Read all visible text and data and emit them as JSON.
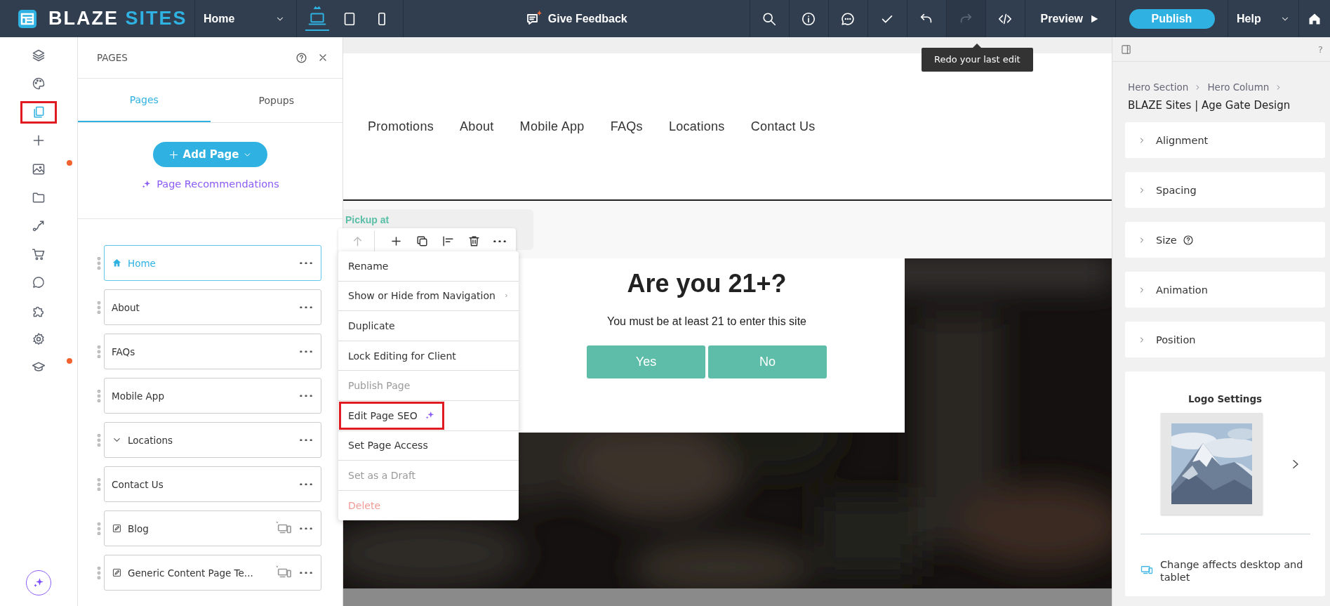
{
  "top_bar": {
    "logo": {
      "primary": "BLAZE",
      "accent": "SITES"
    },
    "page_select": {
      "value": "Home"
    },
    "devices": [
      {
        "kind": "desktop",
        "selected": true
      },
      {
        "kind": "tablet",
        "selected": false
      },
      {
        "kind": "mobile",
        "selected": false
      }
    ],
    "feedback": "Give Feedback",
    "tools": [
      {
        "kind": "search",
        "disabled": false
      },
      {
        "kind": "info",
        "disabled": false
      },
      {
        "kind": "comments",
        "disabled": false
      },
      {
        "kind": "check",
        "disabled": false
      },
      {
        "kind": "undo",
        "disabled": false
      },
      {
        "kind": "redo",
        "disabled": true
      },
      {
        "kind": "code",
        "disabled": false
      }
    ],
    "preview": "Preview",
    "publish": "Publish",
    "help": "Help"
  },
  "tooltip": "Redo your last edit",
  "rail": {
    "items": [
      {
        "kind": "layers",
        "selected": false,
        "highlighted": false,
        "badge": false
      },
      {
        "kind": "palette",
        "selected": false,
        "highlighted": false,
        "badge": false
      },
      {
        "kind": "pages",
        "selected": true,
        "highlighted": true,
        "badge": false
      },
      {
        "kind": "add",
        "selected": false,
        "highlighted": false,
        "badge": false
      },
      {
        "kind": "media",
        "selected": false,
        "highlighted": false,
        "badge": true
      },
      {
        "kind": "folder",
        "selected": false,
        "highlighted": false,
        "badge": false
      },
      {
        "kind": "flow",
        "selected": false,
        "highlighted": false,
        "badge": false
      },
      {
        "kind": "store",
        "selected": false,
        "highlighted": false,
        "badge": false
      },
      {
        "kind": "chat",
        "selected": false,
        "highlighted": false,
        "badge": false
      },
      {
        "kind": "extensions",
        "selected": false,
        "highlighted": false,
        "badge": false
      },
      {
        "kind": "settings",
        "selected": false,
        "highlighted": false,
        "badge": false
      },
      {
        "kind": "learn",
        "selected": false,
        "highlighted": false,
        "badge": true
      }
    ]
  },
  "pages_panel": {
    "title": "PAGES",
    "tabs": [
      {
        "label": "Pages",
        "selected": true
      },
      {
        "label": "Popups",
        "selected": false
      }
    ],
    "add_button": "Add Page",
    "recommendations": "Page Recommendations",
    "pages": [
      {
        "label": "Home",
        "kind": "home",
        "selected": true
      },
      {
        "label": "About",
        "kind": "page",
        "selected": false
      },
      {
        "label": "FAQs",
        "kind": "page",
        "selected": false
      },
      {
        "label": "Mobile App",
        "kind": "page",
        "selected": false
      },
      {
        "label": "Locations",
        "kind": "folder",
        "selected": false
      },
      {
        "label": "Contact Us",
        "kind": "page",
        "selected": false
      },
      {
        "label": "Blog",
        "kind": "dynamic",
        "selected": false
      },
      {
        "label": "Generic Content Page Te...",
        "kind": "dynamic",
        "selected": false
      }
    ]
  },
  "element_toolbar": {
    "tools": [
      {
        "kind": "move-up",
        "disabled": true
      },
      {
        "kind": "add",
        "disabled": false
      },
      {
        "kind": "duplicate",
        "disabled": false
      },
      {
        "kind": "align",
        "disabled": false
      },
      {
        "kind": "delete",
        "disabled": false
      },
      {
        "kind": "more",
        "disabled": false
      }
    ]
  },
  "context_menu": {
    "items": [
      {
        "label": "Rename",
        "kind": "plain",
        "disabled": false,
        "highlighted": false
      },
      {
        "label": "Show or Hide from Navigation",
        "kind": "submenu",
        "disabled": false,
        "highlighted": false
      },
      {
        "label": "Duplicate",
        "kind": "plain",
        "disabled": false,
        "highlighted": false
      },
      {
        "label": "Lock Editing for Client",
        "kind": "plain",
        "disabled": false,
        "highlighted": false
      },
      {
        "label": "Publish Page",
        "kind": "plain",
        "disabled": true,
        "highlighted": false
      },
      {
        "label": "Edit Page SEO",
        "kind": "ai",
        "disabled": false,
        "highlighted": true
      },
      {
        "label": "Set Page Access",
        "kind": "plain",
        "disabled": false,
        "highlighted": false
      },
      {
        "label": "Set as a Draft",
        "kind": "plain",
        "disabled": true,
        "highlighted": false
      },
      {
        "label": "Delete",
        "kind": "danger",
        "disabled": true,
        "highlighted": false
      }
    ]
  },
  "canvas": {
    "nav": [
      "Promotions",
      "About",
      "Mobile App",
      "FAQs",
      "Locations",
      "Contact Us"
    ],
    "banner_text": "Pickup at",
    "age_gate": {
      "title": "Are you 21+?",
      "message": "You must be at least 21 to enter this site",
      "buttons": [
        "Yes",
        "No"
      ]
    }
  },
  "inspector": {
    "help_mark": "?",
    "breadcrumb": [
      "Hero Section",
      "Hero Column"
    ],
    "title": "BLAZE Sites | Age Gate Design",
    "sections": [
      {
        "label": "Alignment",
        "help": false
      },
      {
        "label": "Spacing",
        "help": false
      },
      {
        "label": "Size",
        "help": true
      },
      {
        "label": "Animation",
        "help": false
      },
      {
        "label": "Position",
        "help": false
      }
    ],
    "logo_settings": {
      "title": "Logo Settings",
      "note": "Change affects desktop and tablet"
    }
  }
}
